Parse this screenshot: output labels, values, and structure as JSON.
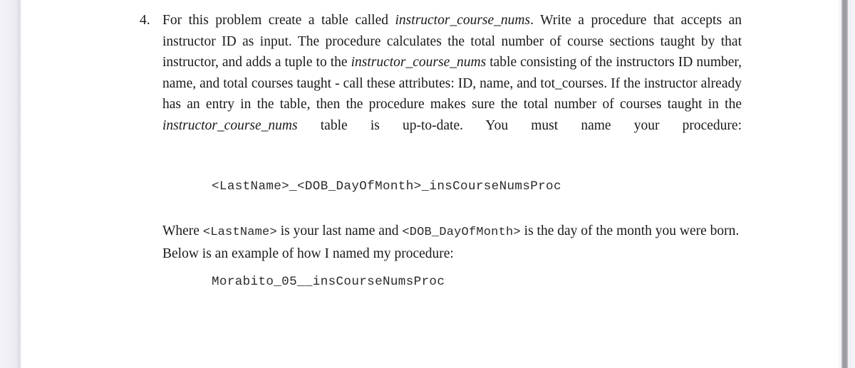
{
  "document": {
    "problem": {
      "number": "4.",
      "statement_parts": [
        {
          "type": "text",
          "value": "For this problem create a table called "
        },
        {
          "type": "italic",
          "value": "instructor_course_nums"
        },
        {
          "type": "text",
          "value": ". Write a procedure that accepts an instructor ID as input.  The procedure calculates the total number of course sections taught by that instructor, and adds a tuple to the "
        },
        {
          "type": "italic",
          "value": "instructor_course_nums"
        },
        {
          "type": "text",
          "value": " table consisting of the instructors ID number, name, and total courses taught - call these attributes: ID, name, and tot_courses.  If the instructor already has an entry in the table, then the procedure makes sure the total number of courses taught in the "
        },
        {
          "type": "italic",
          "value": "instructor_course_nums"
        },
        {
          "type": "text",
          "value": " table is up-to-date.  You must name your procedure:"
        }
      ],
      "statement_segments": {
        "s1": "For this problem create a table called ",
        "i1": "instructor_course_nums",
        "s2": ". Write a procedure that accepts an instructor ID as input.  The procedure calculates the total number of course sections taught by that instructor, and adds a tuple to the ",
        "i2": "instructor_course_nums",
        "s3": " table consisting of the instructors ID number, name, and total courses taught - call these attributes: ID, name, and tot_courses.  If the instructor already has an entry in the table, then the procedure makes sure the total number of courses taught in the ",
        "i3": "instructor_course_nums",
        "s4": " table is up-to-date.  You must name your procedure:"
      }
    },
    "procedure_name_template": "<LastName>_<DOB_DayOfMonth>_insCourseNumsProc",
    "where_clause": {
      "w1": "Where ",
      "code1": "<LastName>",
      "w2": " is your last name and ",
      "code2": "<DOB_DayOfMonth>",
      "w3": " is the day of the month you were born.  Below is an example of how I named my procedure:"
    },
    "procedure_name_example": "Morabito_05__insCourseNumsProc"
  },
  "chrome": {
    "scrollbar": {
      "orientation": "vertical",
      "thumb_color": "#9a9a9f",
      "track_color": "#f1f1f5"
    },
    "left_gutter_color": "#eeeef4",
    "page_background": "#ffffff",
    "text_color": "#1a1a1a"
  }
}
